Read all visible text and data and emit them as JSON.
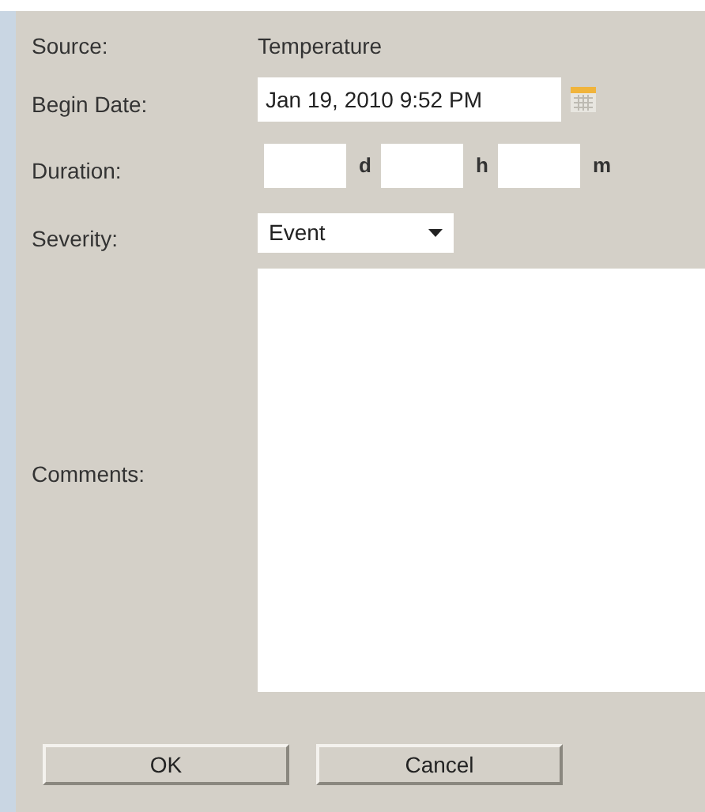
{
  "source": {
    "label": "Source:",
    "value": "Temperature"
  },
  "begin_date": {
    "label": "Begin Date:",
    "value": "Jan 19, 2010 9:52 PM"
  },
  "duration": {
    "label": "Duration:",
    "units": [
      "d",
      "h",
      "m"
    ]
  },
  "severity": {
    "label": "Severity:",
    "value": "Event"
  },
  "comments": {
    "label": "Comments:"
  },
  "buttons": [
    "OK",
    "Cancel"
  ]
}
